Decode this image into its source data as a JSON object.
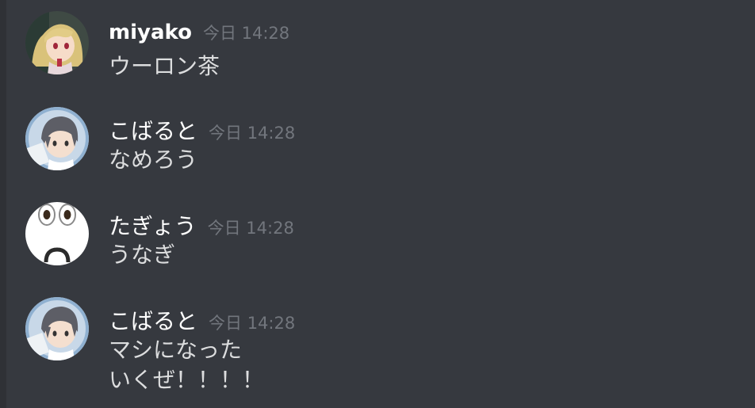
{
  "messages": [
    {
      "username": "miyako",
      "timestamp": "今日 14:28",
      "lines": [
        "ウーロン茶"
      ]
    },
    {
      "username": "こばると",
      "timestamp": "今日 14:28",
      "lines": [
        "なめろう"
      ]
    },
    {
      "username": "たぎょう",
      "timestamp": "今日 14:28",
      "lines": [
        "うなぎ"
      ]
    },
    {
      "username": "こばると",
      "timestamp": "今日 14:28",
      "lines": [
        "マシになった",
        "いくぜ！！！！"
      ]
    }
  ]
}
